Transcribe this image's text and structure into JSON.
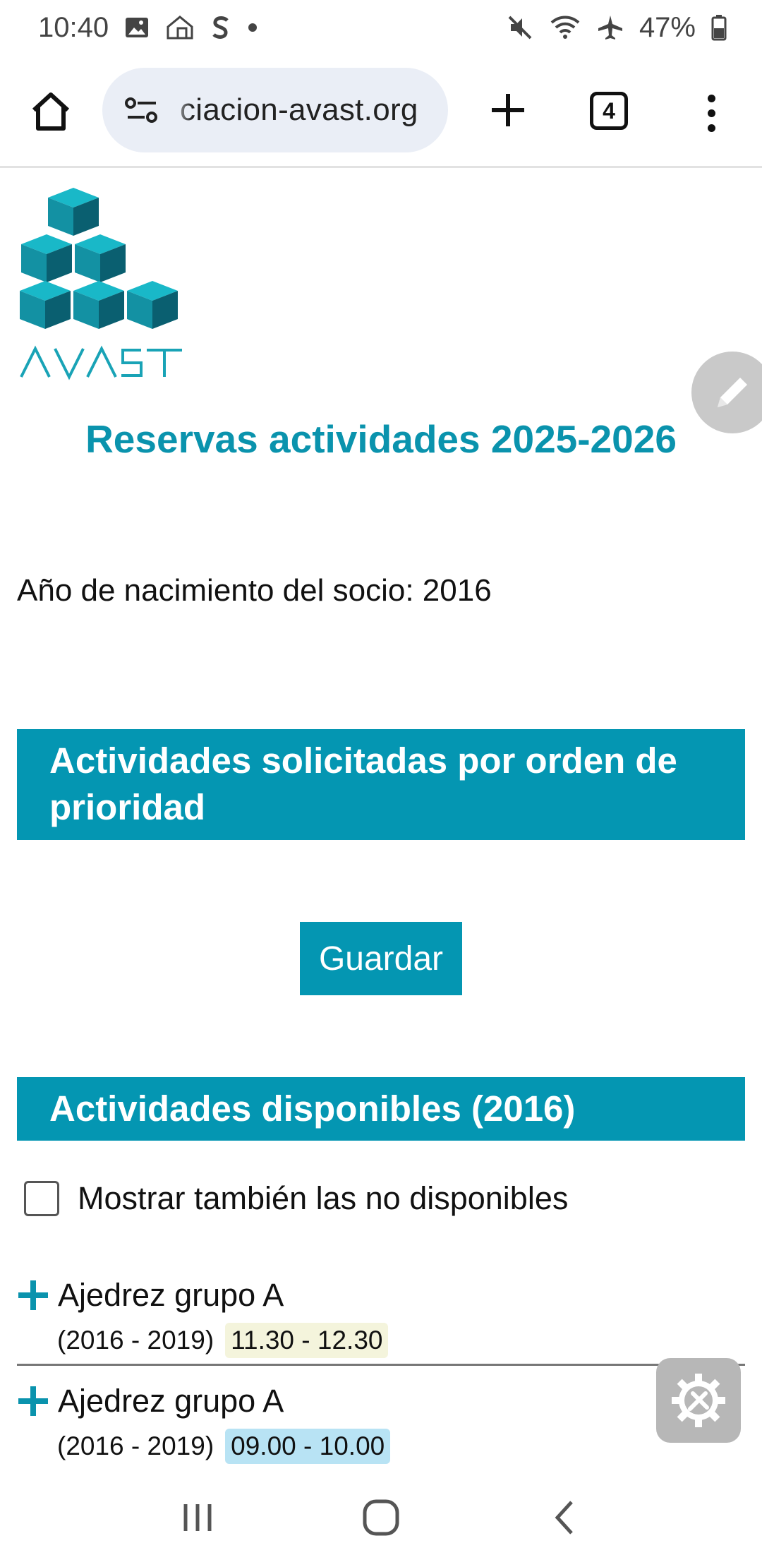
{
  "status_bar": {
    "time": "10:40",
    "battery": "47%"
  },
  "browser": {
    "url": "ciacion-avast.org",
    "tab_count": "4"
  },
  "logo": {
    "text": "AVAST",
    "color": "#19a3b6"
  },
  "page": {
    "title": "Reservas actividades 2025-2026",
    "birth_year_label": "Año de nacimiento del socio: 2016",
    "requested_header": "Actividades solicitadas por orden de prioridad",
    "save_label": "Guardar",
    "available_header": "Actividades disponibles (2016)",
    "show_unavailable_label": "Mostrar también las no disponibles",
    "show_unavailable_checked": false
  },
  "activities": [
    {
      "name": "Ajedrez grupo A",
      "years": "(2016 - 2019)",
      "time": "11.30 - 12.30",
      "time_color": "#f4f4dc"
    },
    {
      "name": "Ajedrez grupo A",
      "years": "(2016 - 2019)",
      "time": "09.00 - 10.00",
      "time_color": "#b8e3f4"
    }
  ],
  "colors": {
    "accent": "#0496b2",
    "title": "#0a93ad"
  },
  "icons": {
    "status": [
      "image-icon",
      "home-device-icon",
      "s-icon",
      "dot-icon",
      "mute-icon",
      "wifi-icon",
      "airplane-icon",
      "battery-icon"
    ],
    "toolbar": [
      "home-icon",
      "site-settings-icon",
      "plus-icon",
      "tabs-icon",
      "more-icon"
    ],
    "fabs": [
      "pencil-icon",
      "gear-tools-icon"
    ],
    "nav": [
      "recents-icon",
      "home-nav-icon",
      "back-icon"
    ]
  }
}
